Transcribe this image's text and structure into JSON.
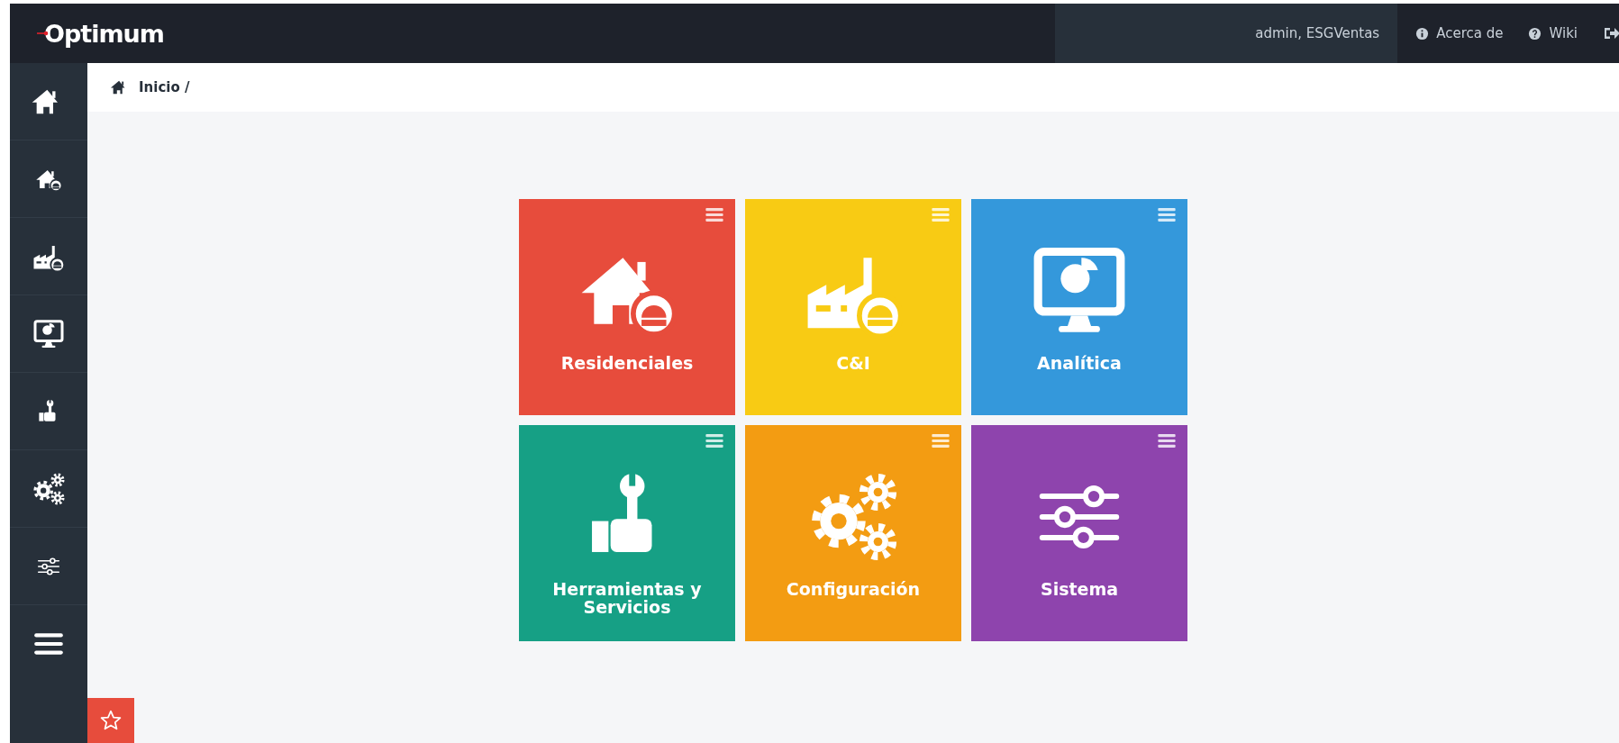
{
  "header": {
    "logo": "Optimum",
    "user": "admin, ESGVentas",
    "links": [
      {
        "kind": "info",
        "label": "Acerca de"
      },
      {
        "kind": "help",
        "label": "Wiki"
      }
    ]
  },
  "sidebar": {
    "items": [
      {
        "kind": "house"
      },
      {
        "kind": "house-meter"
      },
      {
        "kind": "factory-meter"
      },
      {
        "kind": "monitor"
      },
      {
        "kind": "hand-wrench"
      },
      {
        "kind": "gears"
      },
      {
        "kind": "sliders"
      },
      {
        "kind": "menu"
      }
    ]
  },
  "breadcrumb": {
    "label": "Inicio /"
  },
  "tiles": [
    {
      "kind": "house-meter",
      "label": "Residenciales",
      "color": "#e74c3c"
    },
    {
      "kind": "factory-meter",
      "label": "C&I",
      "color": "#f8cb14"
    },
    {
      "kind": "monitor",
      "label": "Analítica",
      "color": "#3498db"
    },
    {
      "kind": "hand-wrench",
      "label": "Herramientas y Servicios",
      "color": "#16a085"
    },
    {
      "kind": "gears",
      "label": "Configuración",
      "color": "#f39c12"
    },
    {
      "kind": "sliders",
      "label": "Sistema",
      "color": "#8e44ad"
    }
  ]
}
